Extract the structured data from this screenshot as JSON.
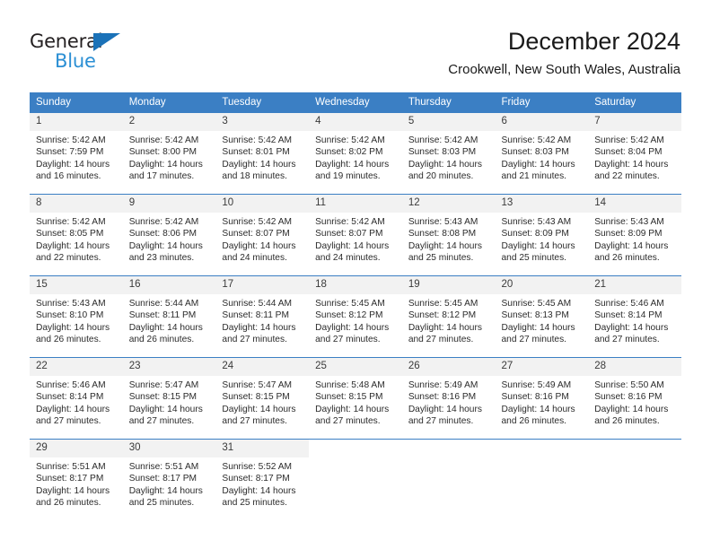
{
  "logo": {
    "word_top": "General",
    "word_bottom": "Blue",
    "triangle_color": "#1b72b8",
    "blue_text_color": "#2b8fd4"
  },
  "header": {
    "title": "December 2024",
    "subtitle": "Crookwell, New South Wales, Australia"
  },
  "theme": {
    "header_blue": "#3b7fc4",
    "daynum_bg": "#f2f2f2",
    "text": "#2b2b2b"
  },
  "weekday_headers": [
    "Sunday",
    "Monday",
    "Tuesday",
    "Wednesday",
    "Thursday",
    "Friday",
    "Saturday"
  ],
  "labels": {
    "sunrise_prefix": "Sunrise: ",
    "sunset_prefix": "Sunset: ",
    "daylight_prefix": "Daylight: "
  },
  "weeks": [
    [
      {
        "day": "1",
        "sunrise": "Sunrise: 5:42 AM",
        "sunset": "Sunset: 7:59 PM",
        "daylight_line1": "Daylight: 14 hours",
        "daylight_line2": "and 16 minutes."
      },
      {
        "day": "2",
        "sunrise": "Sunrise: 5:42 AM",
        "sunset": "Sunset: 8:00 PM",
        "daylight_line1": "Daylight: 14 hours",
        "daylight_line2": "and 17 minutes."
      },
      {
        "day": "3",
        "sunrise": "Sunrise: 5:42 AM",
        "sunset": "Sunset: 8:01 PM",
        "daylight_line1": "Daylight: 14 hours",
        "daylight_line2": "and 18 minutes."
      },
      {
        "day": "4",
        "sunrise": "Sunrise: 5:42 AM",
        "sunset": "Sunset: 8:02 PM",
        "daylight_line1": "Daylight: 14 hours",
        "daylight_line2": "and 19 minutes."
      },
      {
        "day": "5",
        "sunrise": "Sunrise: 5:42 AM",
        "sunset": "Sunset: 8:03 PM",
        "daylight_line1": "Daylight: 14 hours",
        "daylight_line2": "and 20 minutes."
      },
      {
        "day": "6",
        "sunrise": "Sunrise: 5:42 AM",
        "sunset": "Sunset: 8:03 PM",
        "daylight_line1": "Daylight: 14 hours",
        "daylight_line2": "and 21 minutes."
      },
      {
        "day": "7",
        "sunrise": "Sunrise: 5:42 AM",
        "sunset": "Sunset: 8:04 PM",
        "daylight_line1": "Daylight: 14 hours",
        "daylight_line2": "and 22 minutes."
      }
    ],
    [
      {
        "day": "8",
        "sunrise": "Sunrise: 5:42 AM",
        "sunset": "Sunset: 8:05 PM",
        "daylight_line1": "Daylight: 14 hours",
        "daylight_line2": "and 22 minutes."
      },
      {
        "day": "9",
        "sunrise": "Sunrise: 5:42 AM",
        "sunset": "Sunset: 8:06 PM",
        "daylight_line1": "Daylight: 14 hours",
        "daylight_line2": "and 23 minutes."
      },
      {
        "day": "10",
        "sunrise": "Sunrise: 5:42 AM",
        "sunset": "Sunset: 8:07 PM",
        "daylight_line1": "Daylight: 14 hours",
        "daylight_line2": "and 24 minutes."
      },
      {
        "day": "11",
        "sunrise": "Sunrise: 5:42 AM",
        "sunset": "Sunset: 8:07 PM",
        "daylight_line1": "Daylight: 14 hours",
        "daylight_line2": "and 24 minutes."
      },
      {
        "day": "12",
        "sunrise": "Sunrise: 5:43 AM",
        "sunset": "Sunset: 8:08 PM",
        "daylight_line1": "Daylight: 14 hours",
        "daylight_line2": "and 25 minutes."
      },
      {
        "day": "13",
        "sunrise": "Sunrise: 5:43 AM",
        "sunset": "Sunset: 8:09 PM",
        "daylight_line1": "Daylight: 14 hours",
        "daylight_line2": "and 25 minutes."
      },
      {
        "day": "14",
        "sunrise": "Sunrise: 5:43 AM",
        "sunset": "Sunset: 8:09 PM",
        "daylight_line1": "Daylight: 14 hours",
        "daylight_line2": "and 26 minutes."
      }
    ],
    [
      {
        "day": "15",
        "sunrise": "Sunrise: 5:43 AM",
        "sunset": "Sunset: 8:10 PM",
        "daylight_line1": "Daylight: 14 hours",
        "daylight_line2": "and 26 minutes."
      },
      {
        "day": "16",
        "sunrise": "Sunrise: 5:44 AM",
        "sunset": "Sunset: 8:11 PM",
        "daylight_line1": "Daylight: 14 hours",
        "daylight_line2": "and 26 minutes."
      },
      {
        "day": "17",
        "sunrise": "Sunrise: 5:44 AM",
        "sunset": "Sunset: 8:11 PM",
        "daylight_line1": "Daylight: 14 hours",
        "daylight_line2": "and 27 minutes."
      },
      {
        "day": "18",
        "sunrise": "Sunrise: 5:45 AM",
        "sunset": "Sunset: 8:12 PM",
        "daylight_line1": "Daylight: 14 hours",
        "daylight_line2": "and 27 minutes."
      },
      {
        "day": "19",
        "sunrise": "Sunrise: 5:45 AM",
        "sunset": "Sunset: 8:12 PM",
        "daylight_line1": "Daylight: 14 hours",
        "daylight_line2": "and 27 minutes."
      },
      {
        "day": "20",
        "sunrise": "Sunrise: 5:45 AM",
        "sunset": "Sunset: 8:13 PM",
        "daylight_line1": "Daylight: 14 hours",
        "daylight_line2": "and 27 minutes."
      },
      {
        "day": "21",
        "sunrise": "Sunrise: 5:46 AM",
        "sunset": "Sunset: 8:14 PM",
        "daylight_line1": "Daylight: 14 hours",
        "daylight_line2": "and 27 minutes."
      }
    ],
    [
      {
        "day": "22",
        "sunrise": "Sunrise: 5:46 AM",
        "sunset": "Sunset: 8:14 PM",
        "daylight_line1": "Daylight: 14 hours",
        "daylight_line2": "and 27 minutes."
      },
      {
        "day": "23",
        "sunrise": "Sunrise: 5:47 AM",
        "sunset": "Sunset: 8:15 PM",
        "daylight_line1": "Daylight: 14 hours",
        "daylight_line2": "and 27 minutes."
      },
      {
        "day": "24",
        "sunrise": "Sunrise: 5:47 AM",
        "sunset": "Sunset: 8:15 PM",
        "daylight_line1": "Daylight: 14 hours",
        "daylight_line2": "and 27 minutes."
      },
      {
        "day": "25",
        "sunrise": "Sunrise: 5:48 AM",
        "sunset": "Sunset: 8:15 PM",
        "daylight_line1": "Daylight: 14 hours",
        "daylight_line2": "and 27 minutes."
      },
      {
        "day": "26",
        "sunrise": "Sunrise: 5:49 AM",
        "sunset": "Sunset: 8:16 PM",
        "daylight_line1": "Daylight: 14 hours",
        "daylight_line2": "and 27 minutes."
      },
      {
        "day": "27",
        "sunrise": "Sunrise: 5:49 AM",
        "sunset": "Sunset: 8:16 PM",
        "daylight_line1": "Daylight: 14 hours",
        "daylight_line2": "and 26 minutes."
      },
      {
        "day": "28",
        "sunrise": "Sunrise: 5:50 AM",
        "sunset": "Sunset: 8:16 PM",
        "daylight_line1": "Daylight: 14 hours",
        "daylight_line2": "and 26 minutes."
      }
    ],
    [
      {
        "day": "29",
        "sunrise": "Sunrise: 5:51 AM",
        "sunset": "Sunset: 8:17 PM",
        "daylight_line1": "Daylight: 14 hours",
        "daylight_line2": "and 26 minutes."
      },
      {
        "day": "30",
        "sunrise": "Sunrise: 5:51 AM",
        "sunset": "Sunset: 8:17 PM",
        "daylight_line1": "Daylight: 14 hours",
        "daylight_line2": "and 25 minutes."
      },
      {
        "day": "31",
        "sunrise": "Sunrise: 5:52 AM",
        "sunset": "Sunset: 8:17 PM",
        "daylight_line1": "Daylight: 14 hours",
        "daylight_line2": "and 25 minutes."
      },
      {
        "day": "",
        "sunrise": "",
        "sunset": "",
        "daylight_line1": "",
        "daylight_line2": ""
      },
      {
        "day": "",
        "sunrise": "",
        "sunset": "",
        "daylight_line1": "",
        "daylight_line2": ""
      },
      {
        "day": "",
        "sunrise": "",
        "sunset": "",
        "daylight_line1": "",
        "daylight_line2": ""
      },
      {
        "day": "",
        "sunrise": "",
        "sunset": "",
        "daylight_line1": "",
        "daylight_line2": ""
      }
    ]
  ]
}
